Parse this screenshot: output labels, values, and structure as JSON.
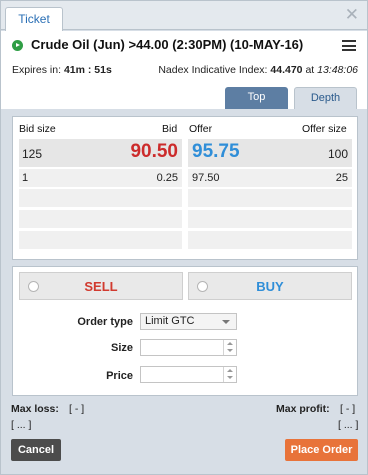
{
  "window": {
    "tab_label": "Ticket",
    "close_icon": "close-icon"
  },
  "header": {
    "status_icon": "play-circle-icon",
    "title": "Crude Oil (Jun) >44.00 (2:30PM) (10-MAY-16)",
    "expires_label": "Expires in:",
    "expires_value": "41m : 51s",
    "index_label": "Nadex Indicative Index:",
    "index_value": "44.470",
    "index_at": "at",
    "index_time": "13:48:06"
  },
  "subtabs": [
    "Top",
    "Depth"
  ],
  "depth": {
    "headers": {
      "bid_size": "Bid size",
      "bid": "Bid",
      "offer": "Offer",
      "offer_size": "Offer size"
    },
    "best": {
      "bid_size": "125",
      "bid": "90.50",
      "offer": "95.75",
      "offer_size": "100"
    },
    "second": {
      "bid_size": "1",
      "bid": "0.25",
      "offer": "97.50",
      "offer_size": "25"
    }
  },
  "order": {
    "sell_label": "SELL",
    "buy_label": "BUY",
    "order_type_label": "Order type",
    "order_type_value": "Limit GTC",
    "size_label": "Size",
    "size_value": "",
    "price_label": "Price",
    "price_value": ""
  },
  "summary": {
    "max_loss_label": "Max loss:",
    "max_loss_value": "[ - ]",
    "max_loss_detail": "[ ... ]",
    "max_profit_label": "Max profit:",
    "max_profit_value": "[ - ]",
    "max_profit_detail": "[ ... ]"
  },
  "actions": {
    "cancel_label": "Cancel",
    "place_label": "Place Order"
  },
  "colors": {
    "bid": "#cc2b2b",
    "offer": "#2f8ed8",
    "place_order": "#e8733a",
    "cancel": "#4c4c4c"
  }
}
